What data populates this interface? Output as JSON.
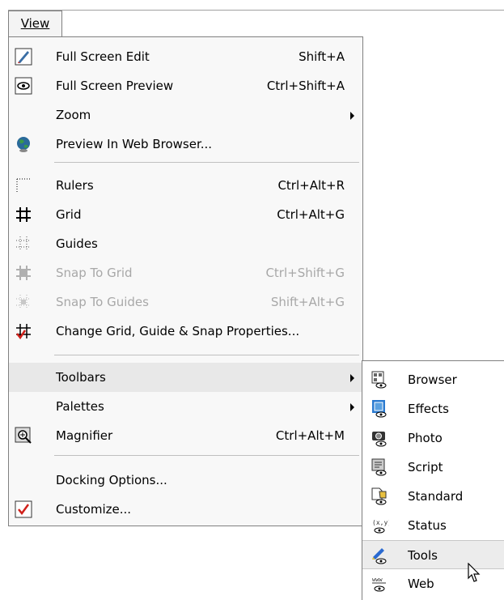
{
  "menubar": {
    "view_label": "View"
  },
  "view_menu": {
    "items": [
      {
        "label": "Full Screen Edit",
        "shortcut": "Shift+A",
        "icon": "full-screen-edit-icon"
      },
      {
        "label": "Full Screen Preview",
        "shortcut": "Ctrl+Shift+A",
        "icon": "eye-icon"
      },
      {
        "label": "Zoom",
        "shortcut": "",
        "submenu": true
      },
      {
        "label": "Preview In Web Browser...",
        "shortcut": "",
        "icon": "globe-icon"
      },
      {
        "label": "Rulers",
        "shortcut": "Ctrl+Alt+R",
        "icon": "rulers-icon"
      },
      {
        "label": "Grid",
        "shortcut": "Ctrl+Alt+G",
        "icon": "grid-icon"
      },
      {
        "label": "Guides",
        "shortcut": "",
        "icon": "guides-icon"
      },
      {
        "label": "Snap To Grid",
        "shortcut": "Ctrl+Shift+G",
        "icon": "snap-grid-icon",
        "disabled": true
      },
      {
        "label": "Snap To Guides",
        "shortcut": "Shift+Alt+G",
        "icon": "snap-guides-icon",
        "disabled": true
      },
      {
        "label": "Change Grid, Guide & Snap Properties...",
        "shortcut": "",
        "icon": "grid-properties-icon"
      },
      {
        "label": "Toolbars",
        "shortcut": "",
        "submenu": true,
        "selected": true
      },
      {
        "label": "Palettes",
        "shortcut": "",
        "submenu": true
      },
      {
        "label": "Magnifier",
        "shortcut": "Ctrl+Alt+M",
        "icon": "magnifier-icon"
      },
      {
        "label": "Docking Options...",
        "shortcut": ""
      },
      {
        "label": "Customize...",
        "shortcut": "",
        "icon": "checkbox-icon"
      }
    ]
  },
  "toolbars_submenu": {
    "items": [
      {
        "label": "Browser",
        "icon": "browser-icon"
      },
      {
        "label": "Effects",
        "icon": "effects-icon"
      },
      {
        "label": "Photo",
        "icon": "photo-icon"
      },
      {
        "label": "Script",
        "icon": "script-icon"
      },
      {
        "label": "Standard",
        "icon": "standard-icon"
      },
      {
        "label": "Status",
        "icon": "status-icon"
      },
      {
        "label": "Tools",
        "icon": "tools-icon",
        "hover": true
      },
      {
        "label": "Web",
        "icon": "web-icon"
      }
    ]
  },
  "colors": {
    "accent": "#3a6ea5",
    "disabled_text": "#a8a8a8",
    "check_red": "#d0201a"
  }
}
